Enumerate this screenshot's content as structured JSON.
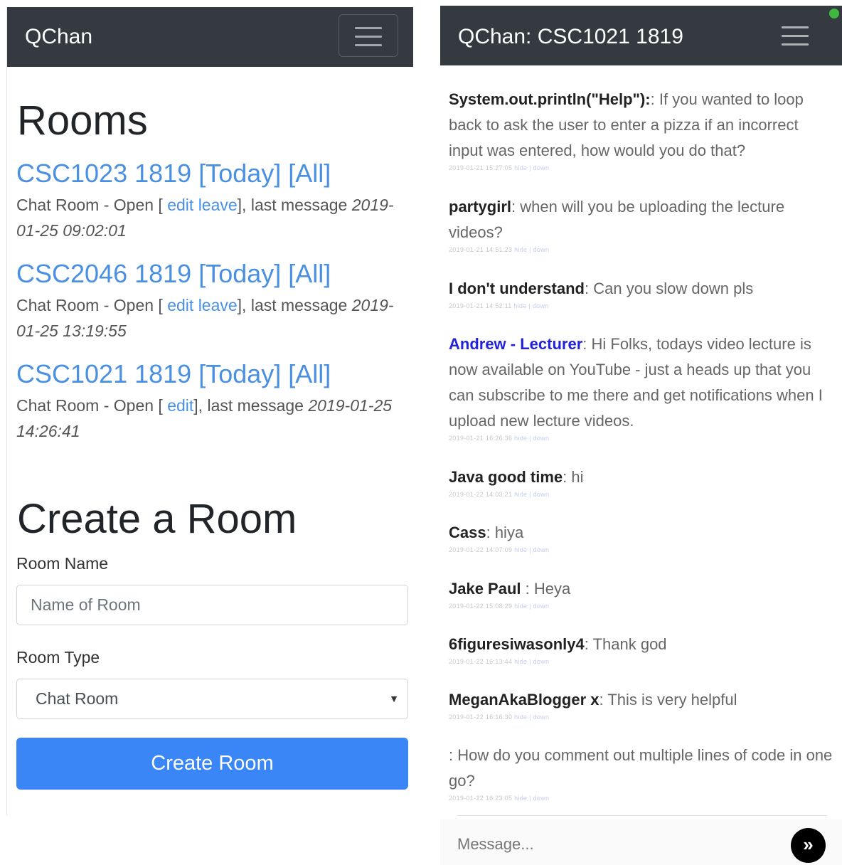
{
  "left": {
    "brand": "QChan",
    "rooms_title": "Rooms",
    "rooms": [
      {
        "name": "CSC1023 1819",
        "today": "[Today]",
        "all": "[All]",
        "type_status": "Chat Room - Open [",
        "edit": "edit",
        "leave": "leave",
        "after_links": "], last message",
        "last_message": "2019-01-25 09:02:01"
      },
      {
        "name": "CSC2046 1819",
        "today": "[Today]",
        "all": "[All]",
        "type_status": "Chat Room - Open [",
        "edit": "edit",
        "leave": "leave",
        "after_links": "], last message",
        "last_message": "2019-01-25 13:19:55"
      },
      {
        "name": "CSC1021 1819",
        "today": "[Today]",
        "all": "[All]",
        "type_status": "Chat Room - Open [",
        "edit": "edit",
        "after_links": "], last message",
        "last_message": "2019-01-25 14:26:41"
      }
    ],
    "create": {
      "title": "Create a Room",
      "name_label": "Room Name",
      "name_placeholder": "Name of Room",
      "type_label": "Room Type",
      "type_selected": "Chat Room",
      "button_label": "Create Room"
    }
  },
  "right": {
    "title": "QChan: CSC1021 1819",
    "messages": [
      {
        "author": "System.out.println(\"Help\"):",
        "text": ": If you wanted to loop back to ask the user to enter a pizza if an incorrect input was entered, how would you do that?",
        "stamp": "2019-01-21 15:27:05"
      },
      {
        "author": "partygirl",
        "text": ": when will you be uploading the lecture videos?",
        "stamp": "2019-01-21 14:51:23"
      },
      {
        "author": "I don't understand",
        "text": ": Can you slow down pls",
        "stamp": "2019-01-21 14:52:11"
      },
      {
        "author": "Andrew - Lecturer",
        "text": ": Hi Folks, todays video lecture is now available on YouTube - just a heads up that you can subscribe to me there and get notifications when I upload new lecture videos.",
        "stamp": "2019-01-21 16:26:36",
        "lecturer": true
      },
      {
        "author": "Java good time",
        "text": ": hi",
        "stamp": "2019-01-22 14:03:21"
      },
      {
        "author": "Cass",
        "text": ": hiya",
        "stamp": "2019-01-22 14:07:09"
      },
      {
        "author": "Jake Paul ",
        "text": ": Heya",
        "stamp": "2019-01-22 15:08:29"
      },
      {
        "author": "6figuresiwasonly4",
        "text": ": Thank god",
        "stamp": "2019-01-22 16:13:44"
      },
      {
        "author": "MeganAkaBlogger x",
        "text": ": This is very helpful",
        "stamp": "2019-01-22 16:16:30"
      },
      {
        "author": "",
        "text": ": How do you comment out multiple lines of code in one go?",
        "stamp": "2019-01-22 16:23:05"
      }
    ],
    "stamp_links": "hide | down",
    "message_placeholder": "Message...",
    "send_icon": "»"
  }
}
